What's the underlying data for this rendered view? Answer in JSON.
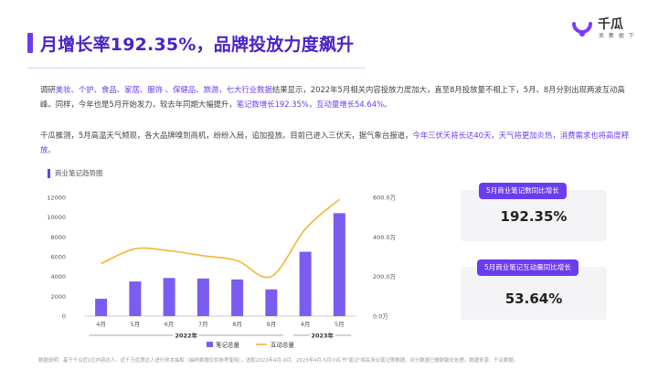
{
  "header": {
    "title": "月增长率192.35%，品牌投放力度飙升",
    "logo_name": "千瓜",
    "logo_sub": "呆 集 据 下"
  },
  "paragraphs": {
    "p1": [
      {
        "t": "调研",
        "hl": false
      },
      {
        "t": "美妆、个护、食品、家居、服饰 、保健品、旅游，七大行业数据",
        "hl": true
      },
      {
        "t": "结果显示，2022年5月相关内容投放力度加大，直至8月投放量不相上下，5月、8月分别出现两波互动高峰。同样，今年也是5月开始发力，较去年同期大幅提升，",
        "hl": false
      },
      {
        "t": "笔记数增长192.35%，互动量增长54.64%。",
        "hl": true
      }
    ],
    "p2": [
      {
        "t": "千瓜推测，5月高温天气频现，各大品牌嗅到商机，纷纷入局，追加投放。目前已进入三伏天，据气象台报道，",
        "hl": false
      },
      {
        "t": "今年三伏天将长达40天，天气将更加炎热，消费需求也将高度释放。",
        "hl": true
      }
    ]
  },
  "chart": {
    "heading": "商业笔记趋势图"
  },
  "chart_data": {
    "type": "bar+line",
    "categories": [
      "4月",
      "5月",
      "6月",
      "7月",
      "8月",
      "9月",
      "4月",
      "5月"
    ],
    "groups": [
      {
        "label": "2022年",
        "from": 0,
        "to": 5
      },
      {
        "label": "2023年",
        "from": 6,
        "to": 7
      }
    ],
    "series": [
      {
        "name": "笔记总量",
        "type": "bar",
        "axis": "left",
        "values": [
          1750,
          3500,
          3850,
          3800,
          3700,
          2700,
          6500,
          10400
        ]
      },
      {
        "name": "互动总量",
        "type": "line",
        "axis": "right",
        "values": [
          265,
          340,
          330,
          305,
          280,
          200,
          440,
          590
        ]
      }
    ],
    "left_axis": {
      "ticks": [
        "0",
        "2000",
        "4000",
        "6000",
        "8000",
        "10000",
        "12000"
      ],
      "ylim": [
        0,
        12000
      ]
    },
    "right_axis": {
      "ticks": [
        "0.0万",
        "200.0万",
        "400.0万",
        "600.0万"
      ],
      "ylim": [
        0,
        600
      ]
    },
    "colors": {
      "bar": "#7b5cf0",
      "line": "#f5b531"
    },
    "legend_position": "bottom",
    "grid": false
  },
  "cards": [
    {
      "label": "5月商业笔记数同比增长",
      "value": "192.35%"
    },
    {
      "label": "5月商业笔记互动量同比增长",
      "value": "53.64%"
    }
  ],
  "footer": "数据说明：基于千瓜近1亿内容达人，近千万优质达人进行样本抽取（抽样数据仅供参考使用）。选取2022年4月-9月、2023年4月-5月小红书\"笔记\"相关商业笔记等数据，对分数据已做脱敏化处理。数据来源：千瓜数据。",
  "colors": {
    "accent": "#6a3cf0",
    "title": "#4b22c9"
  }
}
